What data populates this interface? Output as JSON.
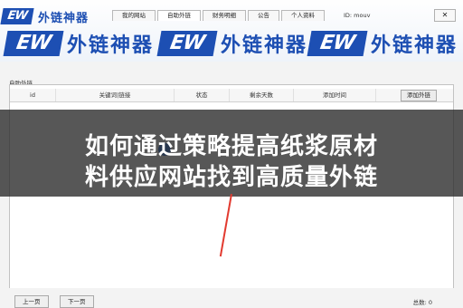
{
  "window": {
    "uid_label": "ID: mouv",
    "close_label": "✕"
  },
  "tabs": [
    "我的网站",
    "自助外链",
    "财务明细",
    "公告",
    "个人资料"
  ],
  "brand": {
    "mark": "EW",
    "name": "外链神器"
  },
  "section": {
    "title": "自助外链"
  },
  "table": {
    "columns": [
      "id",
      "关键词|链接",
      "状态",
      "剩余天数",
      "添加时间"
    ],
    "add_button": "添加外链"
  },
  "overlay": {
    "line1": "如何通过策略提高纸浆原材",
    "line2": "料供应网站找到高质量外链"
  },
  "pager": {
    "prev": "上一页",
    "next": "下一页",
    "total": "总数: 0"
  }
}
